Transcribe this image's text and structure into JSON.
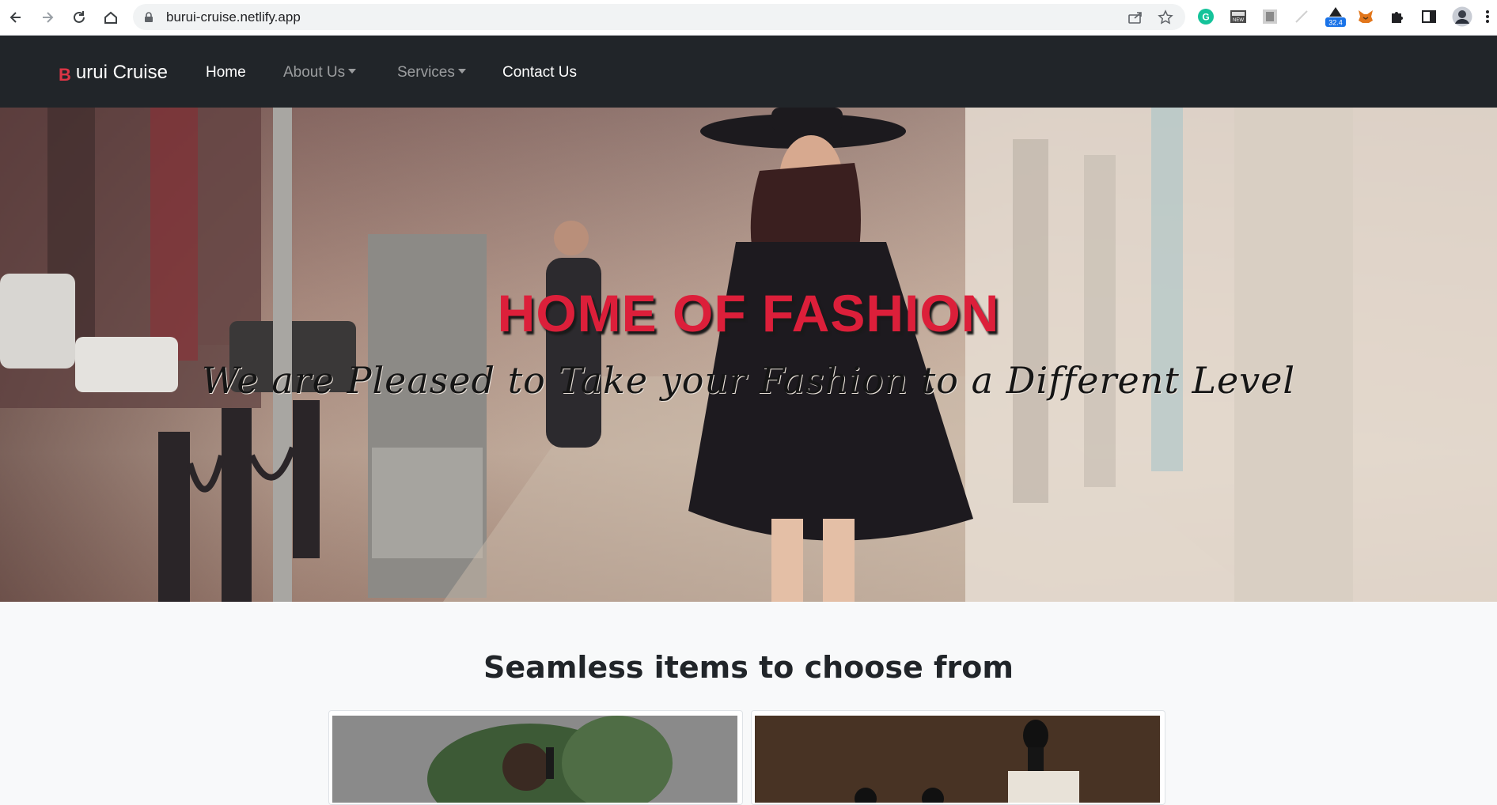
{
  "browser": {
    "url": "burui-cruise.netlify.app",
    "extension_badge": "32.4"
  },
  "navbar": {
    "brand_letter": "B",
    "brand_rest": "urui Cruise",
    "links": [
      {
        "label": "Home"
      },
      {
        "label": "About Us"
      },
      {
        "label": "Services"
      },
      {
        "label": "Contact Us"
      }
    ]
  },
  "hero": {
    "title": "HOME OF FASHION",
    "subtitle": "We are Pleased to Take your Fashion to a Different Level"
  },
  "section": {
    "title": "Seamless items to choose from"
  },
  "colors": {
    "navbar_bg": "#212529",
    "brand_accent": "#dc3545",
    "hero_title": "#dc1f3a",
    "page_bg": "#f8f9fa"
  }
}
